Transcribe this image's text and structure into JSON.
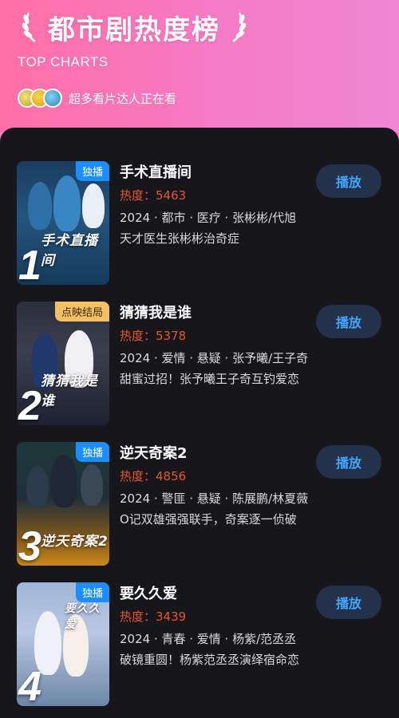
{
  "header": {
    "title": "都市剧热度榜",
    "subtitle": "TOP CHARTS",
    "viewer_text": "超多看片达人正在看",
    "laurel_icon": "laurel-icon"
  },
  "colors": {
    "header_pink": "#ff6fa6",
    "panel_bg": "#17161b",
    "heat_orange": "#e4572e",
    "play_button_bg": "#23324a",
    "play_button_text": "#42a5ff",
    "exclusive_tag": "#1b8fff",
    "ended_tag": "#f3c063"
  },
  "items": [
    {
      "rank": "1",
      "tag": "独播",
      "title": "手术直播间",
      "heat_label": "热度：",
      "heat_value": "5463",
      "meta": "2024 · 都市 · 医疗 · 张彬彬/代旭",
      "desc": "天才医生张彬彬治奇症",
      "poster_caption": "手术直播间",
      "play": "播放"
    },
    {
      "rank": "2",
      "tag": "点映结局",
      "title": "猜猜我是谁",
      "heat_label": "热度：",
      "heat_value": "5378",
      "meta": "2024 · 爱情 · 悬疑 · 张予曦/王子奇",
      "desc": "甜蜜过招！张予曦王子奇互钓爱恋",
      "poster_caption": "猜猜我是谁",
      "play": "播放"
    },
    {
      "rank": "3",
      "tag": "独播",
      "title": "逆天奇案2",
      "heat_label": "热度：",
      "heat_value": "4856",
      "meta": "2024 · 警匪 · 悬疑 · 陈展鹏/林夏薇",
      "desc": "O记双雄强强联手，奇案逐一侦破",
      "poster_caption": "逆天奇案2",
      "play": "播放"
    },
    {
      "rank": "4",
      "tag": "独播",
      "title": "要久久爱",
      "heat_label": "热度：",
      "heat_value": "3439",
      "meta": "2024 · 青春 · 爱情 · 杨紫/范丞丞",
      "desc": "破镜重圆！杨紫范丞丞演绎宿命恋",
      "poster_caption": "要久久爱",
      "play": "播放"
    }
  ]
}
